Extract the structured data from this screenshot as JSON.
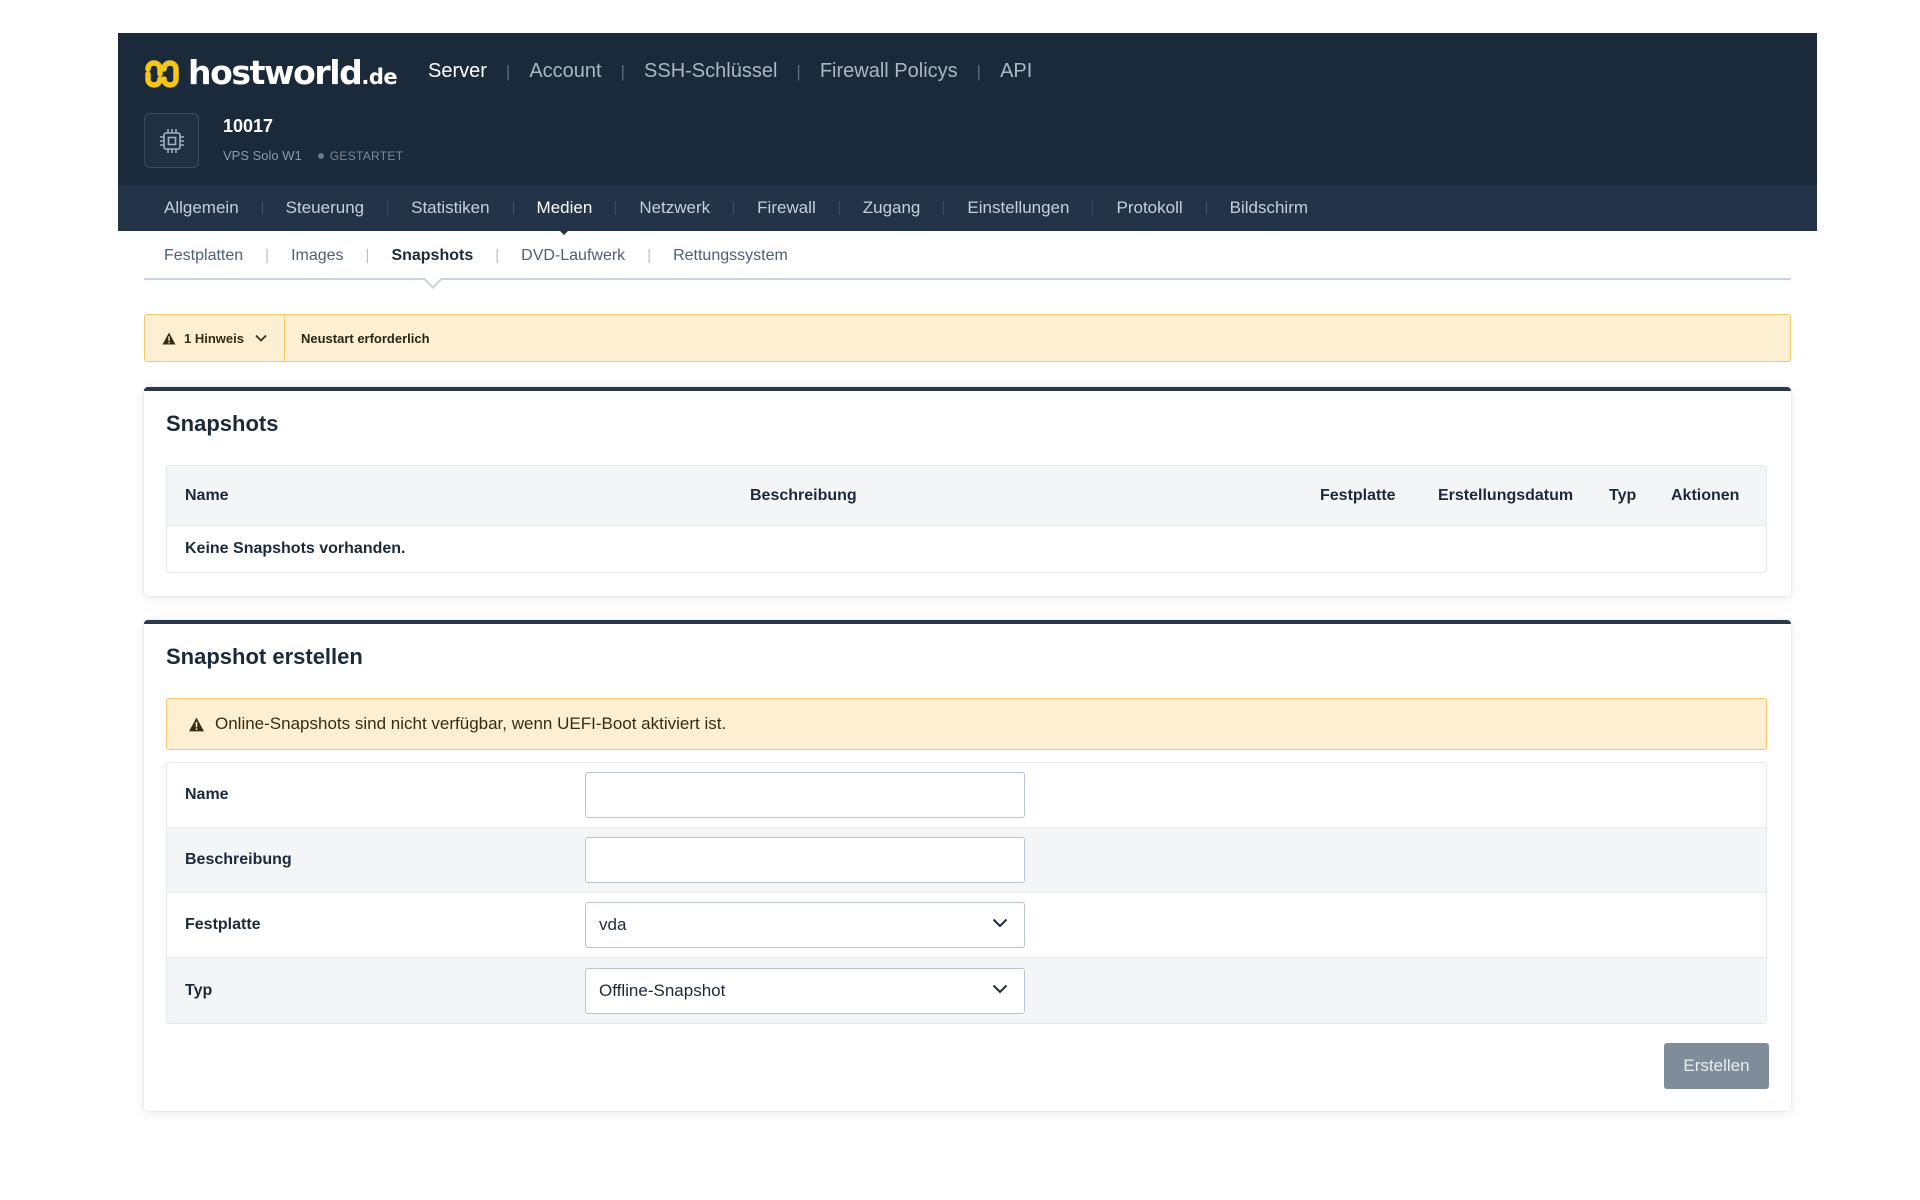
{
  "brand": {
    "name": "hostworld",
    "tld": ".de",
    "logo_color": "#f5c518"
  },
  "topnav": [
    {
      "label": "Server",
      "active": true
    },
    {
      "label": "Account"
    },
    {
      "label": "SSH-Schlüssel"
    },
    {
      "label": "Firewall Policys"
    },
    {
      "label": "API"
    }
  ],
  "server": {
    "id": "10017",
    "plan": "VPS Solo W1",
    "status": "GESTARTET",
    "icon": "cpu-icon"
  },
  "maintabs": [
    "Allgemein",
    "Steuerung",
    "Statistiken",
    "Medien",
    "Netzwerk",
    "Firewall",
    "Zugang",
    "Einstellungen",
    "Protokoll",
    "Bildschirm"
  ],
  "maintabs_active": "Medien",
  "subtabs": [
    "Festplatten",
    "Images",
    "Snapshots",
    "DVD-Laufwerk",
    "Rettungssystem"
  ],
  "subtabs_active": "Snapshots",
  "notice": {
    "count_label": "1 Hinweis",
    "text": "Neustart erforderlich",
    "icon": "warning-icon"
  },
  "snapshots_card": {
    "title": "Snapshots",
    "columns": [
      "Name",
      "Beschreibung",
      "Festplatte",
      "Erstellungsdatum",
      "Typ",
      "Aktionen"
    ],
    "empty_text": "Keine Snapshots vorhanden."
  },
  "create_card": {
    "title": "Snapshot erstellen",
    "warning": "Online-Snapshots sind nicht verfügbar, wenn UEFI-Boot aktiviert ist.",
    "fields": {
      "name": {
        "label": "Name",
        "value": "",
        "placeholder": ""
      },
      "description": {
        "label": "Beschreibung",
        "value": "",
        "placeholder": ""
      },
      "disk": {
        "label": "Festplatte",
        "selected": "vda"
      },
      "type": {
        "label": "Typ",
        "selected": "Offline-Snapshot"
      }
    },
    "submit_label": "Erstellen"
  }
}
